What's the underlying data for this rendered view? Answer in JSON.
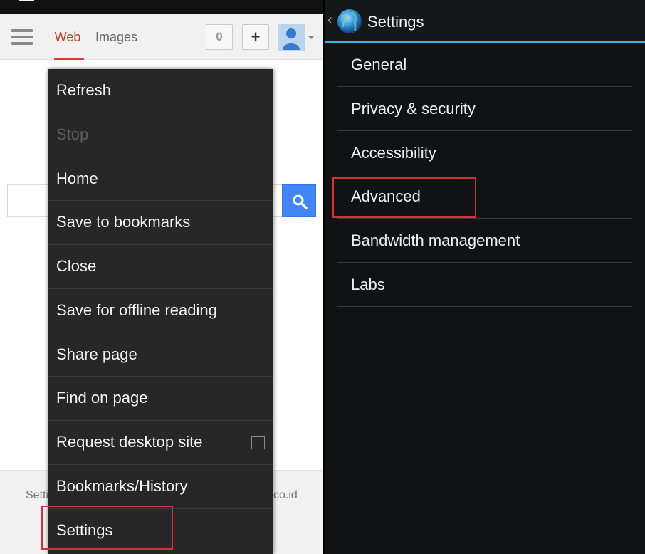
{
  "browser": {
    "tabs": {
      "web": "Web",
      "images": "Images"
    },
    "notification_count": "0",
    "share_label": "+",
    "footer": {
      "left_text": "Setti",
      "right_text": "co.id"
    }
  },
  "menu": {
    "items": [
      {
        "label": "Refresh"
      },
      {
        "label": "Stop"
      },
      {
        "label": "Home"
      },
      {
        "label": "Save to bookmarks"
      },
      {
        "label": "Close"
      },
      {
        "label": "Save for offline reading"
      },
      {
        "label": "Share page"
      },
      {
        "label": "Find on page"
      },
      {
        "label": "Request desktop site"
      },
      {
        "label": "Bookmarks/History"
      },
      {
        "label": "Settings"
      }
    ]
  },
  "settings": {
    "title": "Settings",
    "back": "‹",
    "items": [
      {
        "label": "General"
      },
      {
        "label": "Privacy & security"
      },
      {
        "label": "Accessibility"
      },
      {
        "label": "Advanced"
      },
      {
        "label": "Bandwidth management"
      },
      {
        "label": "Labs"
      }
    ]
  },
  "colors": {
    "highlight": "#d4323a",
    "holo_blue": "#33b5e5",
    "google_blue": "#4285f4",
    "web_tab_red": "#c53929"
  }
}
